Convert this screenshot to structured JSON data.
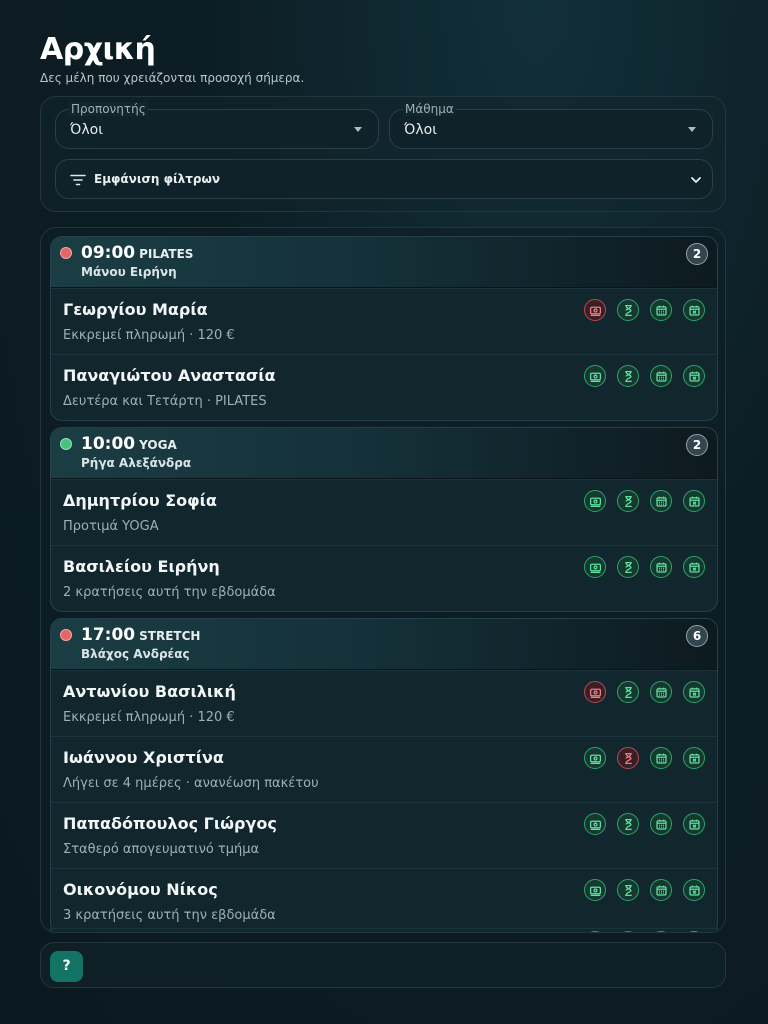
{
  "page": {
    "title": "Αρχική",
    "subtitle": "Δες μέλη που χρειάζονται προσοχή σήμερα."
  },
  "filters": {
    "trainer": {
      "label": "Προπονητής",
      "value": "Όλοι"
    },
    "lesson": {
      "label": "Μάθημα",
      "value": "Όλοι"
    },
    "toggle_label": "Εμφάνιση φίλτρων"
  },
  "icon_names": [
    "cash-icon",
    "hourglass-icon",
    "calendar-icon",
    "cancel-calendar-icon"
  ],
  "colors": {
    "ok": "#5ee0a0",
    "alert": "#f07a86",
    "accent": "#137466",
    "status_red": "#e56464",
    "status_green": "#47c47c"
  },
  "groups": [
    {
      "time": "09:00",
      "class": "PILATES",
      "trainer": "Μάνου Ειρήνη",
      "count": "2",
      "status": "red",
      "members": [
        {
          "name": "Γεωργίου Μαρία",
          "meta": "Εκκρεμεί πληρωμή · 120 €",
          "alerts": [
            "payment"
          ]
        },
        {
          "name": "Παναγιώτου Αναστασία",
          "meta": "Δευτέρα και Τετάρτη · PILATES",
          "alerts": []
        }
      ]
    },
    {
      "time": "10:00",
      "class": "YOGA",
      "trainer": "Ρήγα Αλεξάνδρα",
      "count": "2",
      "status": "green",
      "members": [
        {
          "name": "Δημητρίου Σοφία",
          "meta": "Προτιμά YOGA",
          "alerts": []
        },
        {
          "name": "Βασιλείου Ειρήνη",
          "meta": "2 κρατήσεις αυτή την εβδομάδα",
          "alerts": []
        }
      ]
    },
    {
      "time": "17:00",
      "class": "STRETCH",
      "trainer": "Βλάχος Ανδρέας",
      "count": "6",
      "status": "red",
      "members": [
        {
          "name": "Αντωνίου Βασιλική",
          "meta": "Εκκρεμεί πληρωμή · 120 €",
          "alerts": [
            "payment"
          ]
        },
        {
          "name": "Ιωάννου Χριστίνα",
          "meta": "Λήγει σε 4 ημέρες · ανανέωση πακέτου",
          "alerts": [
            "expiry"
          ]
        },
        {
          "name": "Παπαδόπουλος Γιώργος",
          "meta": "Σταθερό απογευματινό τμήμα",
          "alerts": []
        },
        {
          "name": "Οικονόμου Νίκος",
          "meta": "3 κρατήσεις αυτή την εβδομάδα",
          "alerts": []
        }
      ]
    }
  ],
  "help": {
    "label": "?"
  }
}
